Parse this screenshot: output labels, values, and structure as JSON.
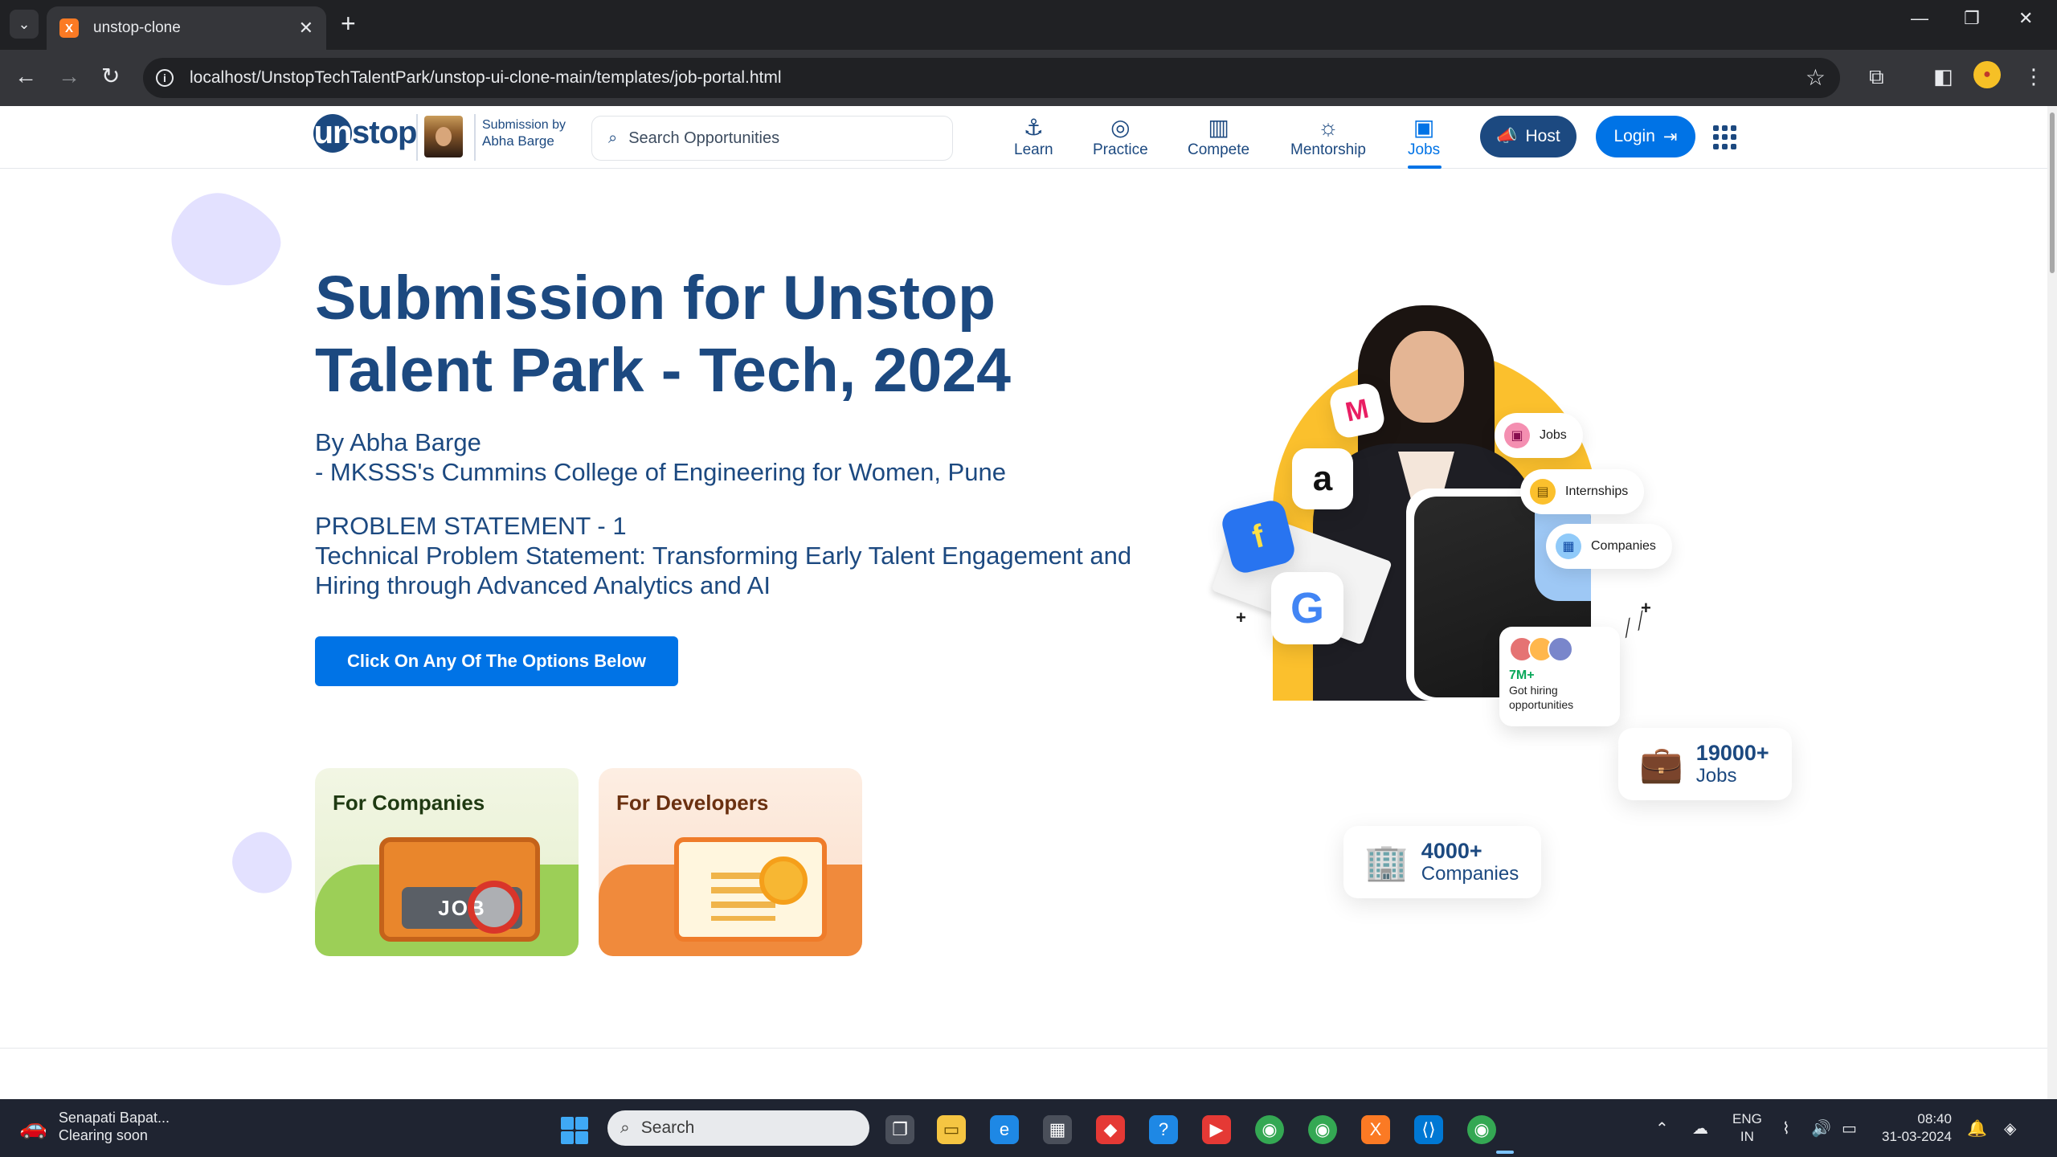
{
  "browser": {
    "tab_title": "unstop-clone",
    "url": "localhost/UnstopTechTalentPark/unstop-ui-clone-main/templates/job-portal.html"
  },
  "header": {
    "logo_text": "unstop",
    "submission_label": "Submission by",
    "submission_name": "Abha Barge",
    "search_placeholder": "Search Opportunities",
    "nav": [
      {
        "label": "Learn",
        "icon": "anchor-icon"
      },
      {
        "label": "Practice",
        "icon": "target-icon"
      },
      {
        "label": "Compete",
        "icon": "podium-icon"
      },
      {
        "label": "Mentorship",
        "icon": "bulb-icon"
      },
      {
        "label": "Jobs",
        "icon": "briefcase-icon",
        "active": true
      }
    ],
    "host_label": "Host",
    "login_label": "Login"
  },
  "hero": {
    "title": "Submission for Unstop Talent Park - Tech, 2024",
    "author": "By Abha Barge",
    "college": "- MKSSS's Cummins College of Engineering for Women, Pune",
    "problem_heading": "PROBLEM STATEMENT - 1",
    "problem_text": "Technical Problem Statement: Transforming Early Talent Engagement and Hiring through Advanced Analytics and AI",
    "cta_label": "Click On Any Of The Options Below"
  },
  "cards": [
    {
      "title": "For Companies",
      "art_text": "JOB"
    },
    {
      "title": "For Developers"
    }
  ],
  "illustration": {
    "pills": [
      "Jobs",
      "Internships",
      "Companies"
    ],
    "hiring_count": "7M+",
    "hiring_text": "Got hiring opportunities",
    "stats": [
      {
        "number": "19000+",
        "label": "Jobs"
      },
      {
        "number": "4000+",
        "label": "Companies"
      }
    ]
  },
  "taskbar": {
    "weather_title": "Senapati Bapat...",
    "weather_sub": "Clearing soon",
    "search_label": "Search",
    "lang_1": "ENG",
    "lang_2": "IN",
    "time": "08:40",
    "date": "31-03-2024"
  },
  "colors": {
    "brand_navy": "#1c4980",
    "brand_blue": "#0073e6",
    "accent_yellow": "#fbc02d"
  }
}
